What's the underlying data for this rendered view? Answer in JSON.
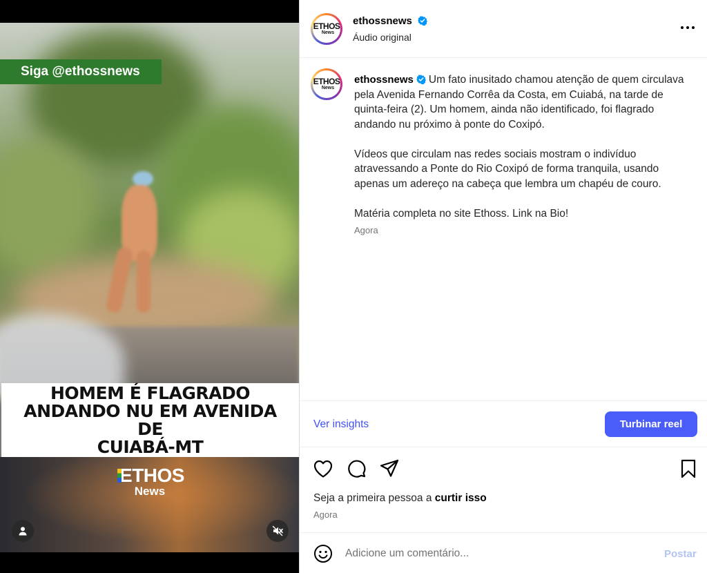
{
  "media": {
    "follow_banner": "Siga @ethossnews",
    "headline": "HOMEM É FLAGRADO\nANDANDO NU EM AVENIDA DE\nCUIABÁ-MT",
    "logo_line1": "ETHOS",
    "logo_line2": "News",
    "tag_icon": "person-tag-icon",
    "mute_icon": "muted-speaker-icon"
  },
  "header": {
    "avatar_line1": "ETHOS",
    "avatar_line2": "News",
    "username": "ethossnews",
    "audio": "Áudio original"
  },
  "caption": {
    "username": "ethossnews",
    "paragraphs": [
      "Um fato inusitado chamou atenção de quem circulava pela Avenida Fernando Corrêa da Costa, em Cuiabá, na tarde de quinta-feira (2). Um homem, ainda não identificado, foi flagrado andando nu próximo à ponte do Coxipó.",
      "Vídeos que circulam nas redes sociais mostram o indivíduo atravessando a Ponte do Rio Coxipó de forma tranquila, usando apenas um adereço na cabeça que lembra um chapéu de couro.",
      "Matéria completa no site Ethoss. Link na Bio!"
    ],
    "time": "Agora"
  },
  "insights": {
    "link_label": "Ver insights",
    "boost_label": "Turbinar reel"
  },
  "likes": {
    "prefix": "Seja a primeira pessoa a ",
    "action": "curtir isso",
    "time": "Agora"
  },
  "comment": {
    "placeholder": "Adicione um comentário...",
    "post_label": "Postar"
  },
  "colors": {
    "accent_blue": "#4a5df9",
    "link_blue": "#4150f7",
    "verified_blue": "#0095f6",
    "banner_green": "#2e7b2d"
  }
}
